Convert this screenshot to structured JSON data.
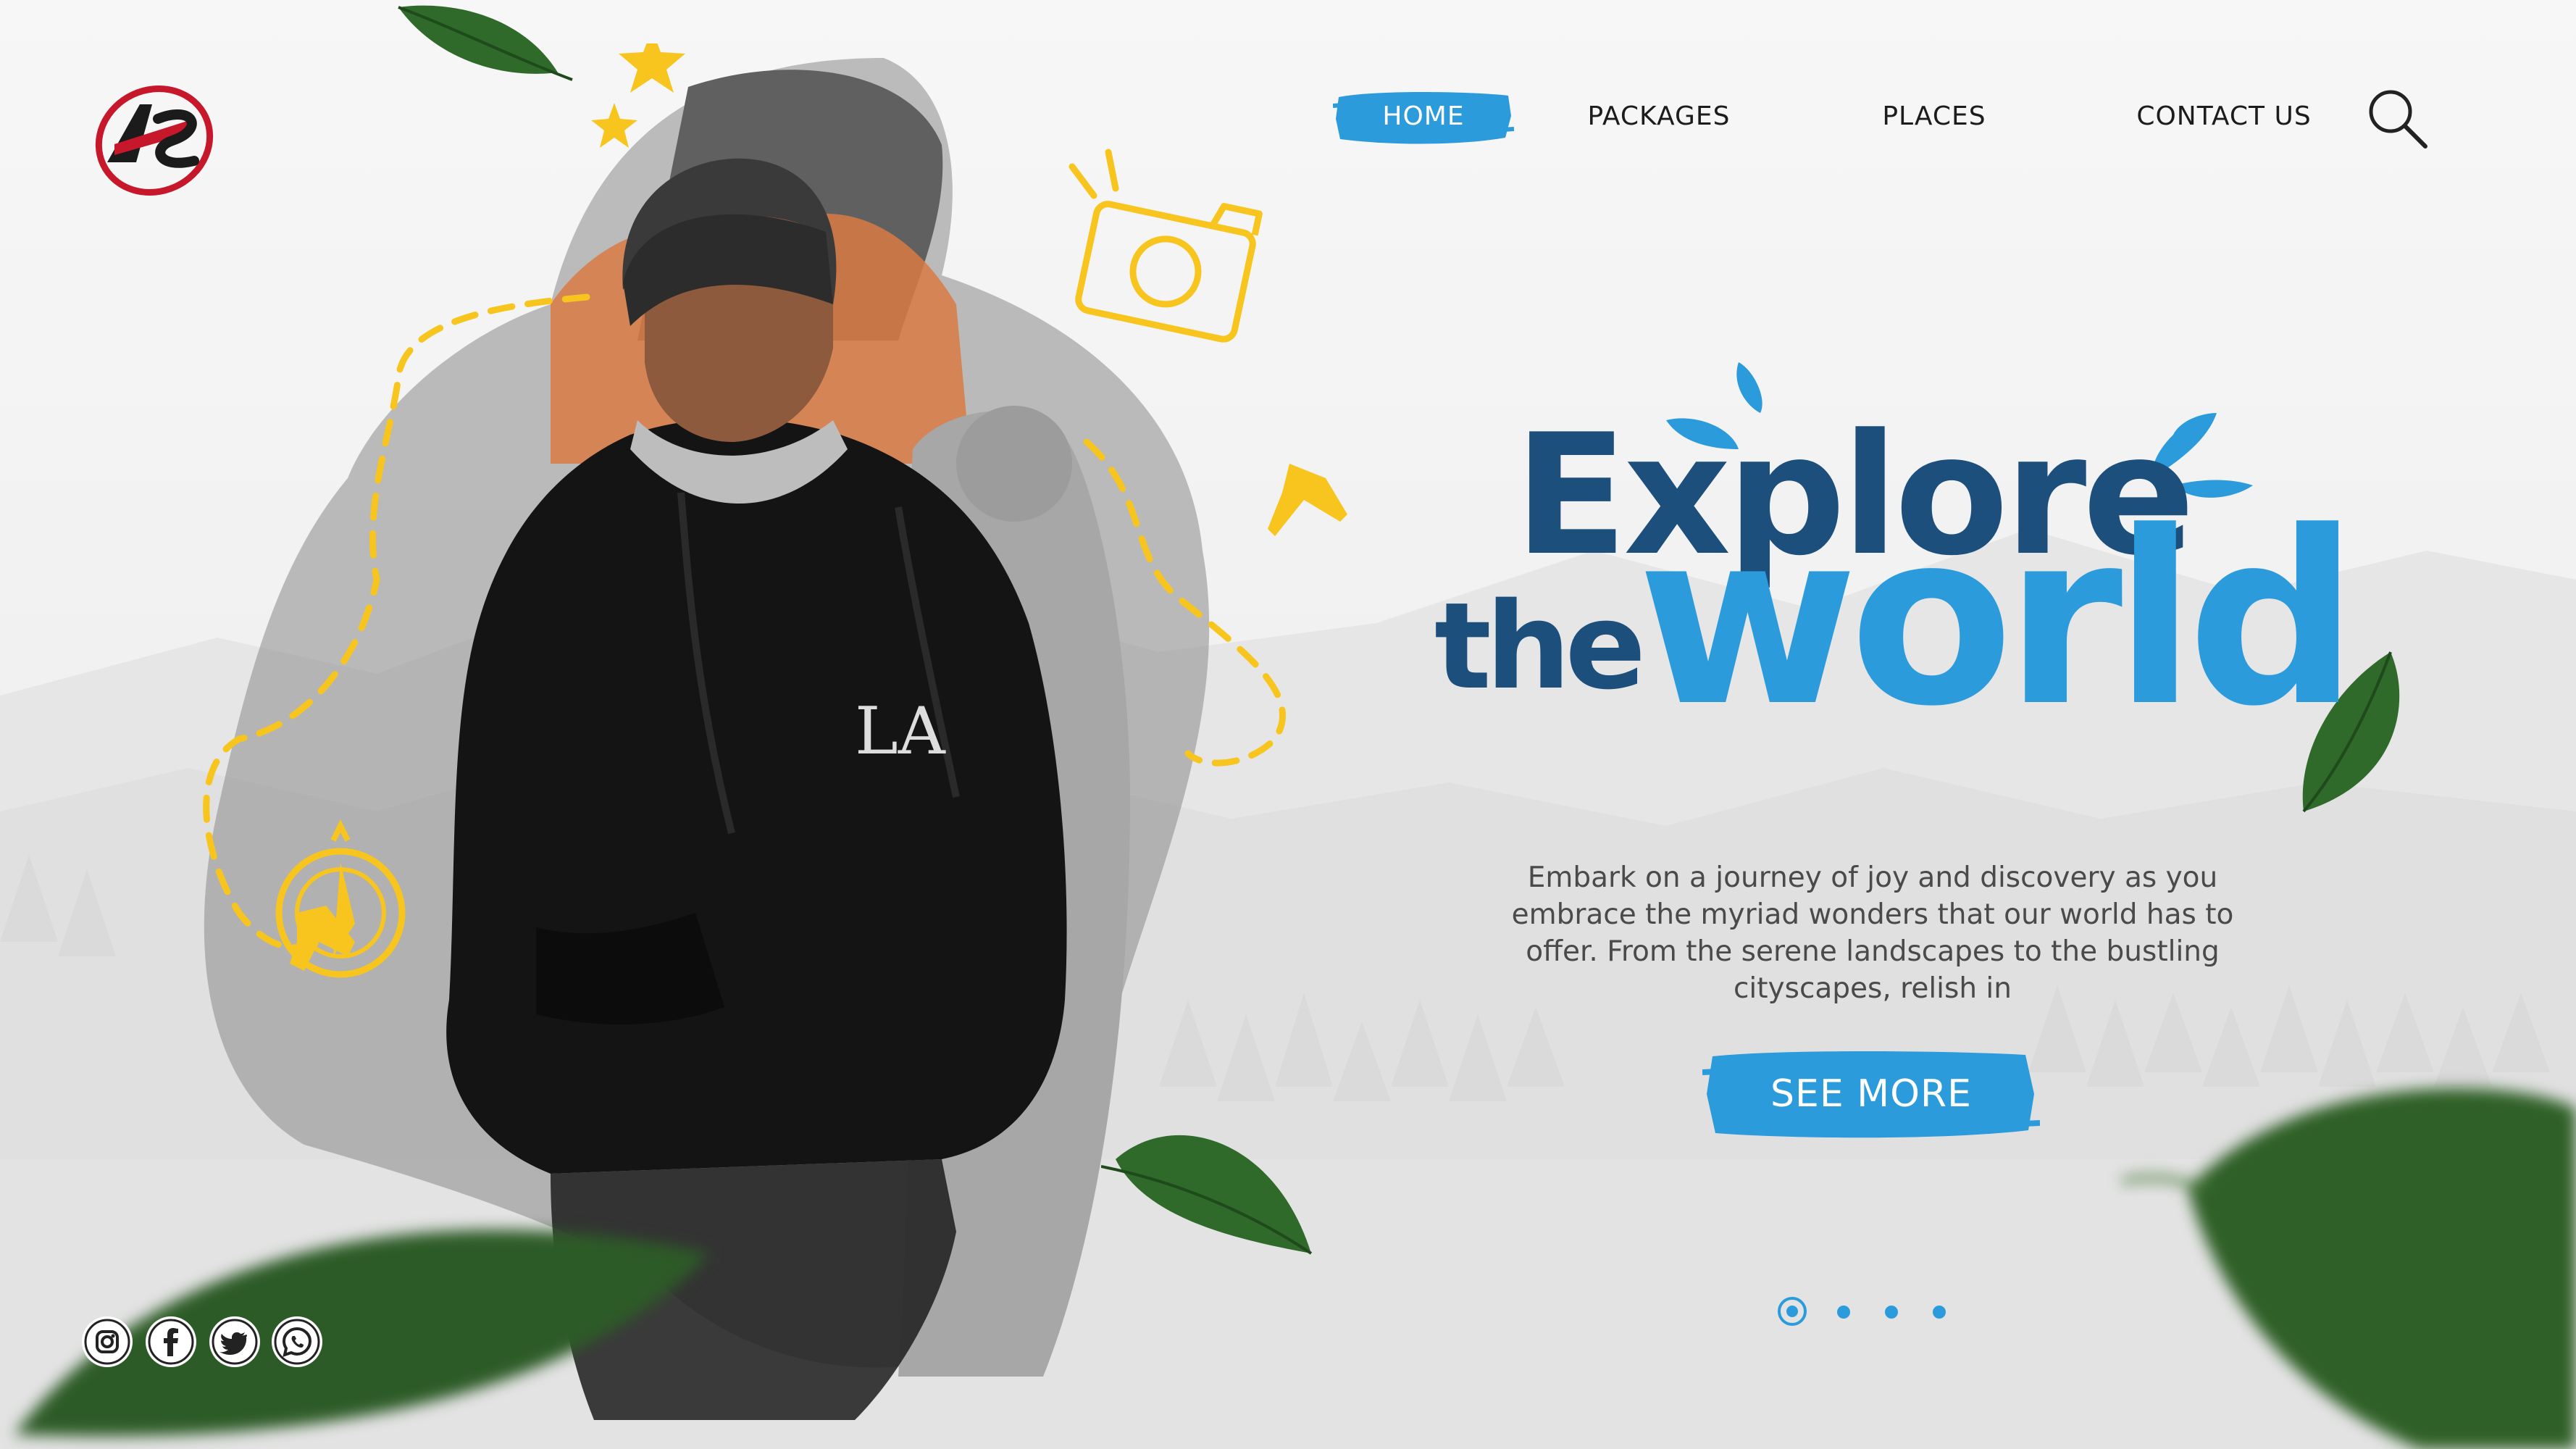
{
  "brand": {
    "logo_letters": "AS"
  },
  "nav": {
    "items": [
      {
        "label": "HOME",
        "active": true
      },
      {
        "label": "PACKAGES"
      },
      {
        "label": "PLACES"
      },
      {
        "label": "CONTACT US"
      }
    ],
    "search_icon": "search-icon"
  },
  "hero": {
    "headline_line1": "Explore",
    "headline_the": "the",
    "headline_world": "world",
    "description": "Embark on a journey of joy and discovery as you embrace the myriad wonders that our world has to offer. From the serene landscapes to the bustling cityscapes, relish in",
    "cta_label": "SEE MORE"
  },
  "carousel": {
    "count": 4,
    "active_index": 0
  },
  "social": [
    "instagram-icon",
    "facebook-icon",
    "twitter-icon",
    "whatsapp-icon"
  ],
  "colors": {
    "accent_blue": "#2b9bdc",
    "dark_blue": "#1c4f7c",
    "doodle_yellow": "#f7c51e",
    "leaf_green": "#2f6a2a",
    "hoodie_black": "#141414"
  }
}
